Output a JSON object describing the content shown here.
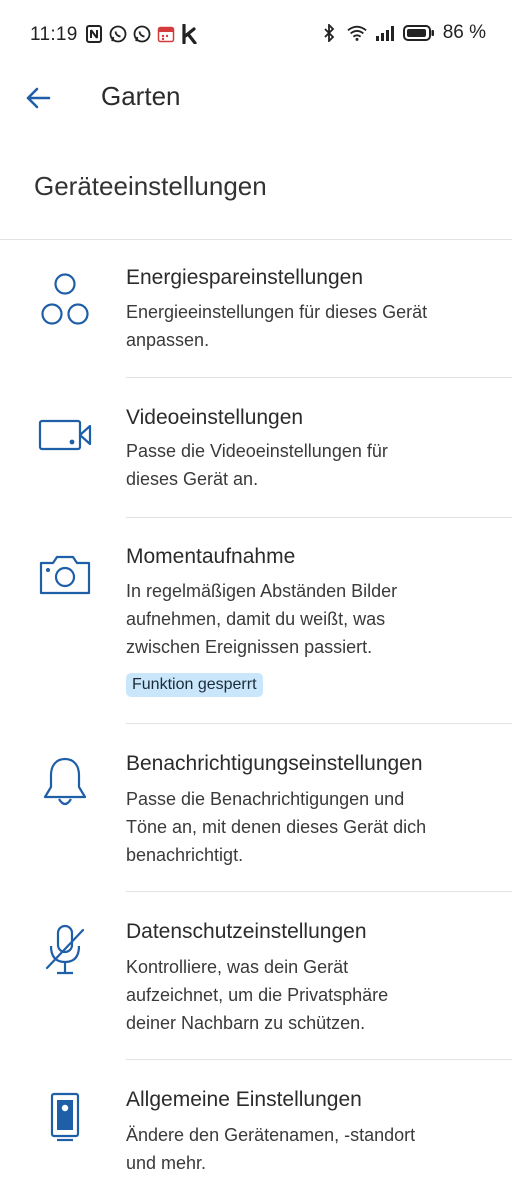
{
  "status_bar": {
    "time": "11:19",
    "battery": "86 %",
    "icons_left": [
      "nfc-icon",
      "whatsapp-icon",
      "whatsapp-icon",
      "calendar-icon",
      "k-app-icon"
    ],
    "icons_right": [
      "bluetooth-icon",
      "wifi-icon",
      "signal-icon",
      "battery-icon"
    ]
  },
  "header": {
    "title": "Garten"
  },
  "section": {
    "title": "Geräteeinstellungen"
  },
  "items": [
    {
      "title": "Energiespareinstellungen",
      "line1": "Energieeinstellungen für dieses Gerät",
      "line2": "anpassen.",
      "icon": "three-circles-icon"
    },
    {
      "title": "Videoeinstellungen",
      "line1": "Passe die Videoeinstellungen für",
      "line2": "dieses Gerät an.",
      "icon": "video-camera-icon"
    },
    {
      "title": "Momentaufnahme",
      "line1": "In regelmäßigen Abständen Bilder",
      "line2": "aufnehmen, damit du weißt, was",
      "line3": "zwischen Ereignissen passiert.",
      "badge": "Funktion gesperrt",
      "icon": "photo-camera-icon"
    },
    {
      "title": "Benachrichtigungseinstellungen",
      "line1": "Passe die Benachrichtigungen und",
      "line2": "Töne an, mit denen dieses Gerät dich",
      "line3": "benachrichtigt.",
      "icon": "bell-icon"
    },
    {
      "title": "Datenschutzeinstellungen",
      "line1": "Kontrolliere, was dein Gerät",
      "line2": "aufzeichnet, um die Privatsphäre",
      "line3": "deiner Nachbarn zu schützen.",
      "icon": "mic-off-icon"
    },
    {
      "title": "Allgemeine Einstellungen",
      "line1": "Ändere den Gerätenamen, -standort",
      "line2": "und mehr.",
      "icon": "device-icon"
    }
  ],
  "colors": {
    "accent": "#1f5fa8",
    "badge_bg": "#c9e6fb",
    "divider": "#e2e2e2"
  }
}
